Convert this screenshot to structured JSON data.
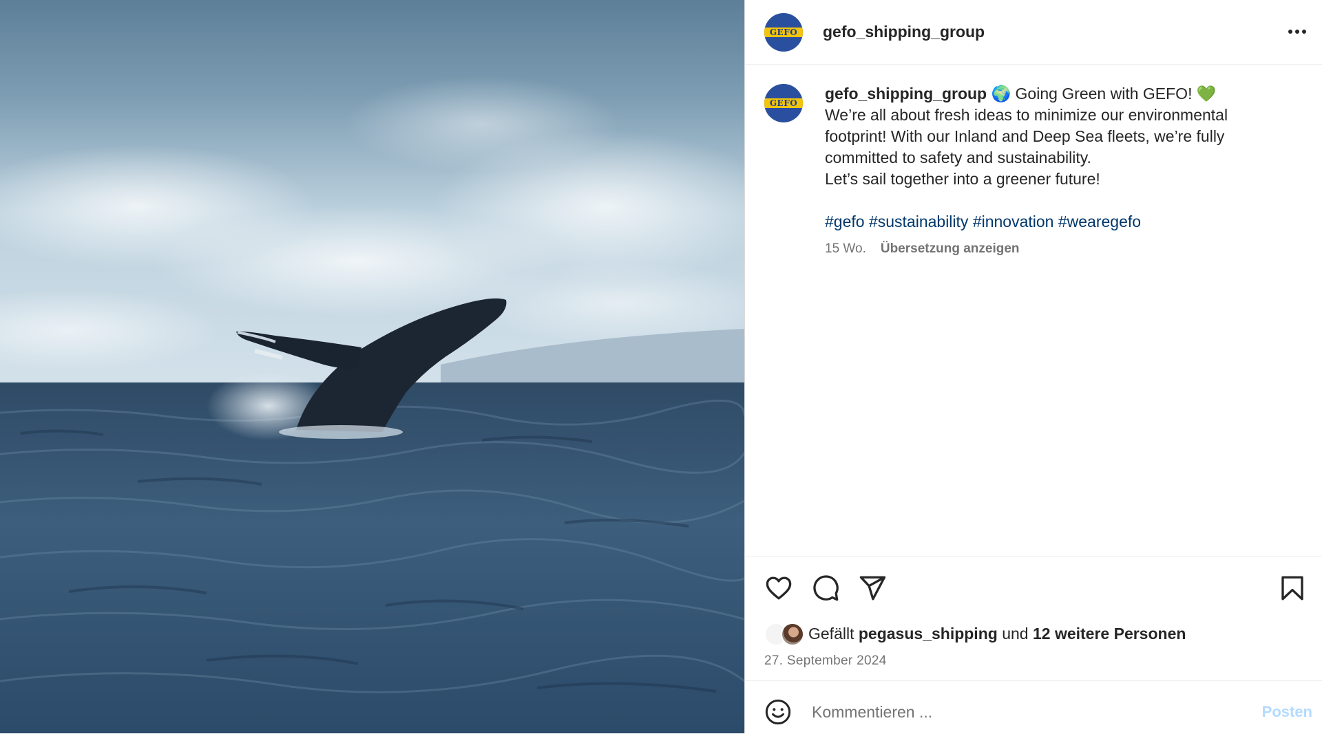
{
  "post": {
    "image": {
      "description_icon": "humpback-whale-breaching-photo"
    },
    "header": {
      "username": "gefo_shipping_group",
      "avatar_text": "GEFO",
      "more_icon": "more-horizontal-icon"
    },
    "caption": {
      "username": "gefo_shipping_group",
      "lines": [
        " 🌍 Going Green with GEFO! 💚",
        "We’re all about fresh ideas to minimize our environmental",
        "footprint! With our Inland and Deep Sea fleets, we’re fully",
        "committed to safety and sustainability.",
        "Let’s sail together into a greener future!"
      ],
      "hashtags": [
        "#gefo",
        "#sustainability",
        "#innovation",
        "#wearegefo"
      ],
      "age": "15 Wo.",
      "translate_label": "Übersetzung anzeigen"
    },
    "actions": {
      "like_icon": "heart-icon",
      "comment_icon": "comment-icon",
      "share_icon": "paper-plane-icon",
      "save_icon": "bookmark-icon"
    },
    "likes": {
      "prefix": "Gefällt",
      "user": "pegasus_shipping",
      "middle": "und",
      "others": "12 weitere Personen"
    },
    "date": "27. September 2024",
    "comment": {
      "placeholder": "Kommentieren ...",
      "post_label": "Posten"
    }
  },
  "colors": {
    "avatar_blue": "#2a4f9e",
    "avatar_yellow": "#f2c40c",
    "hashtag": "#00376b",
    "muted": "#737373",
    "post_button_disabled": "#b3dbff"
  }
}
